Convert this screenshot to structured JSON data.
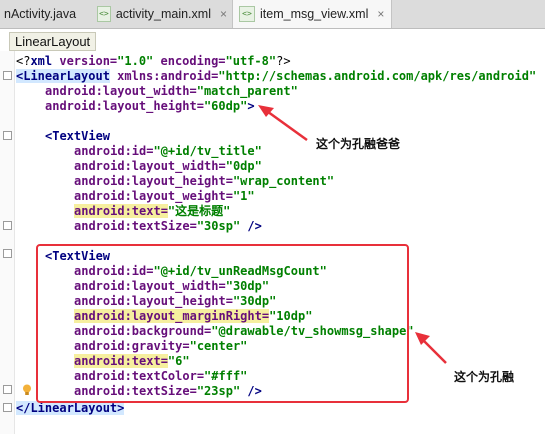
{
  "tabs": [
    {
      "label": "nActivity.java",
      "type": "java",
      "active": false
    },
    {
      "label": "activity_main.xml",
      "type": "xml",
      "active": false
    },
    {
      "label": "item_msg_view.xml",
      "type": "xml",
      "active": true
    }
  ],
  "xml_icon_text": "<>",
  "close_glyph": "×",
  "breadcrumb": "LinearLayout",
  "code": {
    "l1_pre": "<?",
    "l1_xml": "xml ",
    "l1_version_attr": "version=",
    "l1_version_val": "\"1.0\"",
    "l1_enc_attr": " encoding=",
    "l1_enc_val": "\"utf-8\"",
    "l1_end": "?>",
    "l2_open": "<LinearLayout",
    "l2_attr": " xmlns:android=",
    "l2_val": "\"http://schemas.android.com/apk/res/android\"",
    "l3_attr": "android:layout_width=",
    "l3_val": "\"match_parent\"",
    "l4_attr": "android:layout_height=",
    "l4_val": "\"60dp\"",
    "l4_end": ">",
    "l6_open": "<TextView",
    "l7_attr": "android:id=",
    "l7_val": "\"@+id/tv_title\"",
    "l8_attr": "android:layout_width=",
    "l8_val": "\"0dp\"",
    "l9_attr": "android:layout_height=",
    "l9_val": "\"wrap_content\"",
    "l10_attr": "android:layout_weight=",
    "l10_val": "\"1\"",
    "l11_attr": "android:text=",
    "l11_val": "\"这是标题\"",
    "l12_attr": "android:textSize=",
    "l12_val": "\"30sp\"",
    "l12_end": " />",
    "l14_open": "<TextView",
    "l15_attr": "android:id=",
    "l15_val": "\"@+id/tv_unReadMsgCount\"",
    "l16_attr": "android:layout_width=",
    "l16_val": "\"30dp\"",
    "l17_attr": "android:layout_height=",
    "l17_val": "\"30dp\"",
    "l18_attr": "android:layout_marginRight=",
    "l18_val": "\"10dp\"",
    "l19_attr": "android:background=",
    "l19_val": "\"@drawable/tv_showmsg_shape\"",
    "l20_attr": "android:gravity=",
    "l20_val": "\"center\"",
    "l21_attr": "android:text=",
    "l21_val": "\"6\"",
    "l22_attr": "android:textColor=",
    "l22_val": "\"#fff\"",
    "l23_attr": "android:textSize=",
    "l23_val": "\"23sp\"",
    "l23_end": " />",
    "l24_close": "</LinearLayout>"
  },
  "annotations": {
    "parent": "这个为孔融爸爸",
    "child": "这个为孔融"
  },
  "colors": {
    "tag": "#000080",
    "attribute": "#660e7a",
    "value": "#008000",
    "annotation_box": "#e8303a",
    "arrow": "#e8303a"
  }
}
